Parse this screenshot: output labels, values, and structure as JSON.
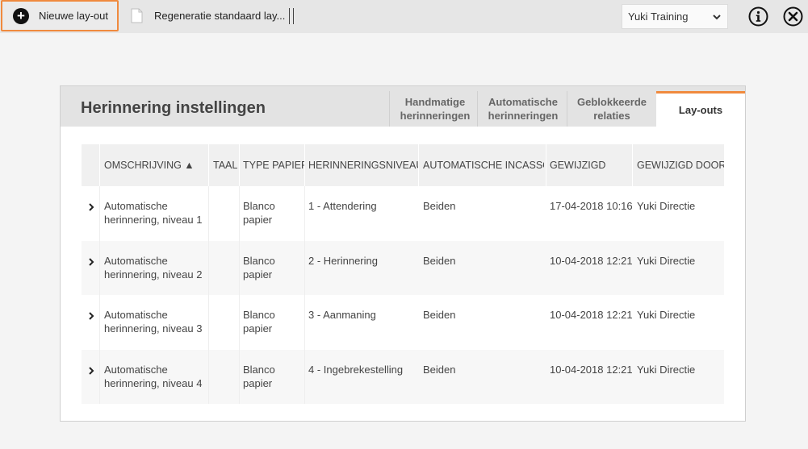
{
  "toolbar": {
    "new_layout_label": "Nieuwe lay-out",
    "regenerate_label": "Regeneratie standaard lay...",
    "company_value": "Yuki Training",
    "icons": {
      "new": "plus-circle-icon",
      "regen": "document-icon",
      "info": "info-icon",
      "close": "close-icon"
    }
  },
  "panel": {
    "title": "Herinnering instellingen",
    "tabs": [
      {
        "line1": "Handmatige",
        "line2": "herinneringen",
        "active": false
      },
      {
        "line1": "Automatische",
        "line2": "herinneringen",
        "active": false
      },
      {
        "line1": "Geblokkeerde",
        "line2": "relaties",
        "active": false
      },
      {
        "line1": "Lay-outs",
        "line2": "",
        "active": true
      }
    ],
    "accent_color": "#f08a3e"
  },
  "table": {
    "columns": [
      "OMSCHRIJVING ▲",
      "TAAL",
      "TYPE PAPIER",
      "HERINNERINGSNIVEAU",
      "AUTOMATISCHE INCASSO",
      "GEWIJZIGD",
      "GEWIJZIGD DOOR"
    ],
    "rows": [
      {
        "desc1": "Automatische",
        "desc2": "herinnering, niveau 1",
        "taal": "",
        "paper1": "Blanco",
        "paper2": "papier",
        "level": "1 - Attendering",
        "incasso": "Beiden",
        "changed": "17-04-2018 10:16",
        "by": "Yuki Directie"
      },
      {
        "desc1": "Automatische",
        "desc2": "herinnering, niveau 2",
        "taal": "",
        "paper1": "Blanco",
        "paper2": "papier",
        "level": "2 - Herinnering",
        "incasso": "Beiden",
        "changed": "10-04-2018 12:21",
        "by": "Yuki Directie"
      },
      {
        "desc1": "Automatische",
        "desc2": "herinnering, niveau 3",
        "taal": "",
        "paper1": "Blanco",
        "paper2": "papier",
        "level": "3 - Aanmaning",
        "incasso": "Beiden",
        "changed": "10-04-2018 12:21",
        "by": "Yuki Directie"
      },
      {
        "desc1": "Automatische",
        "desc2": "herinnering, niveau 4",
        "taal": "",
        "paper1": "Blanco",
        "paper2": "papier",
        "level": "4 - Ingebrekestelling",
        "incasso": "Beiden",
        "changed": "10-04-2018 12:21",
        "by": "Yuki Directie"
      }
    ]
  }
}
